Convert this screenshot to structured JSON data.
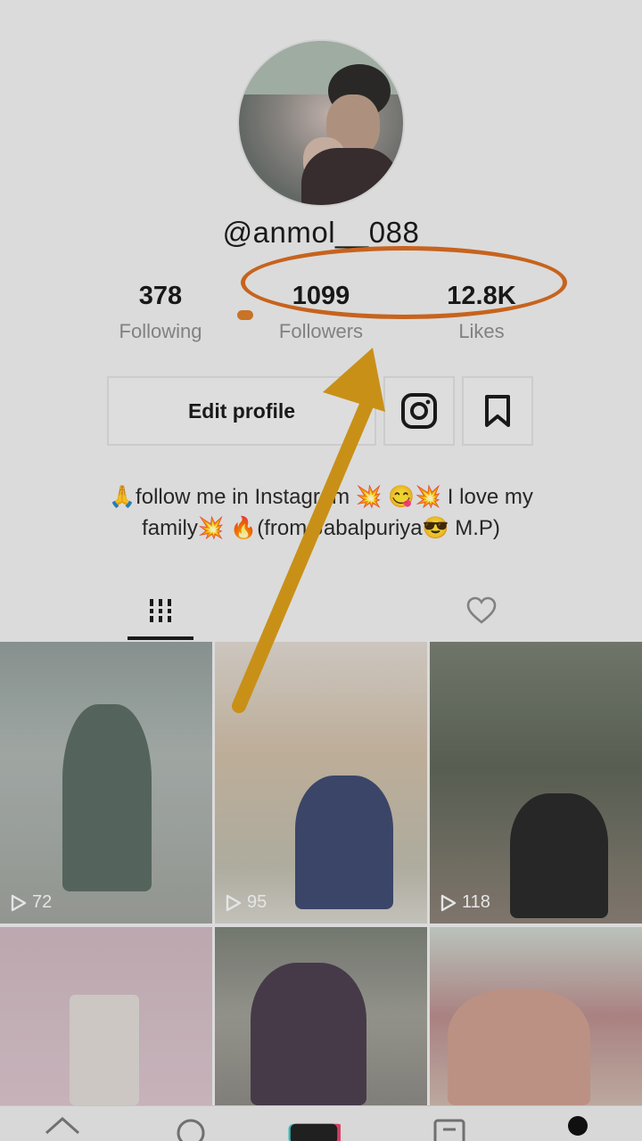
{
  "profile": {
    "username": "@anmol__088",
    "stats": {
      "following": {
        "value": "378",
        "label": "Following"
      },
      "followers": {
        "value": "1099",
        "label": "Followers"
      },
      "likes": {
        "value": "12.8K",
        "label": "Likes"
      }
    },
    "edit_label": "Edit profile",
    "bio_line1": "🙏follow  me in  Instagram 💥 😋💥 I love my",
    "bio_line2": "family💥  🔥(from Jabalpuriya😎 M.P)"
  },
  "tabs": {
    "videos_icon": "grid-icon",
    "liked_icon": "heart-icon"
  },
  "videos": [
    {
      "plays": "72"
    },
    {
      "plays": "95"
    },
    {
      "plays": "118"
    },
    {
      "plays": ""
    },
    {
      "plays": ""
    },
    {
      "plays": ""
    }
  ],
  "nav": {
    "icons": [
      "home-icon",
      "discover-icon",
      "create-icon",
      "inbox-icon",
      "profile-icon"
    ]
  },
  "colors": {
    "annotation_orange": "#d46a1f",
    "annotation_arrow": "#d69a1a"
  }
}
